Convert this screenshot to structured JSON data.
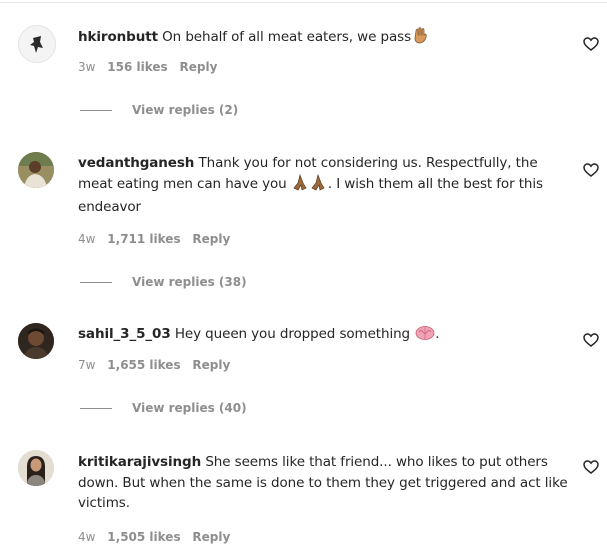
{
  "comments": [
    {
      "username": "hkironbutt",
      "text": "On behalf of all meat eaters, we pass",
      "emoji_icon": "hand-icon",
      "time": "3w",
      "likes": "156 likes",
      "reply": "Reply",
      "view_replies": "View replies (2)"
    },
    {
      "username": "vedanthganesh",
      "text": "Thank you for not considering us. Respectfully, the meat eating men can have you",
      "emoji_icon": "folded-hands-icon",
      "text_after": ". I wish them all the best for this endeavor",
      "time": "4w",
      "likes": "1,711 likes",
      "reply": "Reply",
      "view_replies": "View replies (38)"
    },
    {
      "username": "sahil_3_5_03",
      "text": "Hey queen you dropped something",
      "emoji_icon": "brain-icon",
      "text_after": ".",
      "time": "7w",
      "likes": "1,655 likes",
      "reply": "Reply",
      "view_replies": "View replies (40)"
    },
    {
      "username": "kritikarajivsingh",
      "text": "She seems like that friend... who likes to put others down. But when the same is done to them they get triggered and act like victims.",
      "time": "4w",
      "likes": "1,505 likes",
      "reply": "Reply"
    }
  ],
  "colors": {
    "text": "#262626",
    "secondary": "#8e8e8e",
    "background": "#ffffff"
  }
}
